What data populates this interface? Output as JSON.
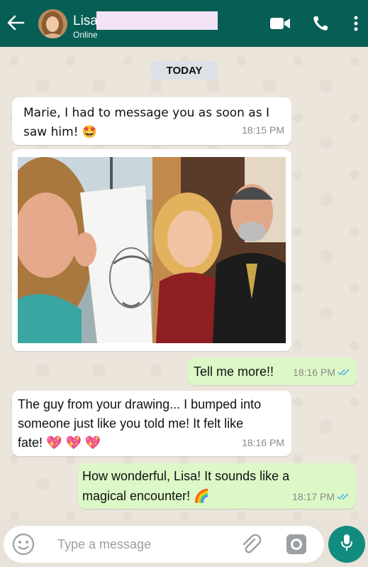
{
  "header": {
    "contact_name": "Lisa",
    "status": "Online",
    "colors": {
      "bar": "#075e54",
      "accent": "#128c7e"
    },
    "icons": [
      "back-arrow-icon",
      "video-call-icon",
      "phone-icon",
      "more-vert-icon"
    ]
  },
  "chat": {
    "date_label": "TODAY",
    "messages": [
      {
        "direction": "in",
        "text_line1": "Marie, I had to message you as soon as I",
        "text_line2": "saw him! 🤩",
        "time": "18:15 PM"
      },
      {
        "direction": "in",
        "type": "image",
        "description_icon": "photo-collage"
      },
      {
        "direction": "out",
        "text": "Tell me more!!",
        "time": "18:16 PM",
        "status": "read"
      },
      {
        "direction": "in",
        "text_line1": "The guy from your drawing... I bumped into",
        "text_line2": "someone just like you told me! It felt like",
        "text_line3": "fate! 💖 💖 💖",
        "time": "18:16 PM"
      },
      {
        "direction": "out",
        "text_line1": "How wonderful, Lisa! It sounds like a",
        "text_line2": "magical encounter! 🌈",
        "time": "18:17 PM",
        "status": "read"
      }
    ]
  },
  "composer": {
    "placeholder": "Type a message",
    "icons": [
      "emoji-icon",
      "attach-icon",
      "camera-icon",
      "mic-icon"
    ]
  }
}
